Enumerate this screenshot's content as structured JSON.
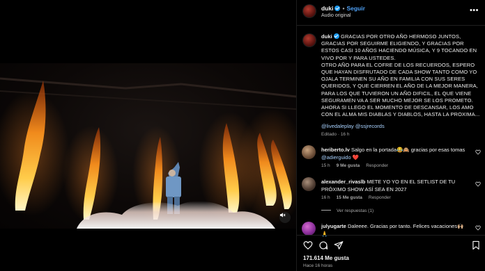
{
  "media": {
    "mute_icon": "speaker-muted-icon"
  },
  "header": {
    "username": "duki",
    "separator": "•",
    "follow_label": "Seguir",
    "audio_label": "Audio original",
    "more_icon": "more-horizontal-icon"
  },
  "caption": {
    "username": "duki",
    "paragraph1": "GRACIAS POR OTRO AÑO HERMOSO JUNTOS, GRACIAS POR SEGUIRME ELIGIENDO, Y GRACIAS POR ESTOS CASI 10 AÑOS HACIENDO MÚSICA, Y 9 TOCANDO EN VIVO POR Y PARA USTEDES.",
    "paragraph2": "OTRO AÑO PARA EL COFRE DE LOS RECUERDOS, ESPERO QUE HAYAN DISFRUTADO DE CADA SHOW TANTO COMO YO OJALA TERMINEN SU AÑO EN FAMILIA CON SUS SERES QUERIDOS, Y QUE CIERREN EL AÑO DE LA MEJOR MANERA, PARA LOS QUE TUVIERON UN AÑO DIFICIL, EL QUE VIENE SEGURAMEN VA A SER MUCHO MEJOR SE LOS PROMETO. AHORA SI LLEGO EL MOMENTO DE DESCANSAR, LOS AMO CON EL ALMA MIS DIABLAS Y DIABLOS, HASTA LA PROXIMA...",
    "mention1": "@livedaleplay",
    "mention2": "@ssjrecords",
    "edited": "Editado · 16 h"
  },
  "comments": [
    {
      "username": "heriberto.lv",
      "text": "Salgo en la portada😂🙈 gracias por esas tomas",
      "mention": "@adierguido",
      "emoji": "❤️",
      "time": "15 h",
      "likes": "9 Me gusta",
      "reply": "Responder"
    },
    {
      "username": "alexander_rivaslb",
      "text": "METE YO YO EN EL SETLIST DE TU PRÓXIMO SHOW ASÍ SEA EN 2027",
      "time": "16 h",
      "likes": "15 Me gusta",
      "reply": "Responder"
    },
    {
      "username": "julyugarte",
      "text": "Daleeee. Gracias por tanto. Felices vacaciones🙌🏼",
      "extra": "🙏"
    }
  ],
  "replies_label": "Ver respuestas (1)",
  "actions": {
    "like_icon": "heart-icon",
    "comment_icon": "comment-icon",
    "share_icon": "share-icon",
    "save_icon": "bookmark-icon",
    "likes": "171.614 Me gusta",
    "posted": "Hace 16 horas"
  },
  "colors": {
    "accent": "#4ea0f5",
    "verified": "#1d9bf0",
    "link": "#a9d2ff",
    "heart": "#ed4956"
  }
}
